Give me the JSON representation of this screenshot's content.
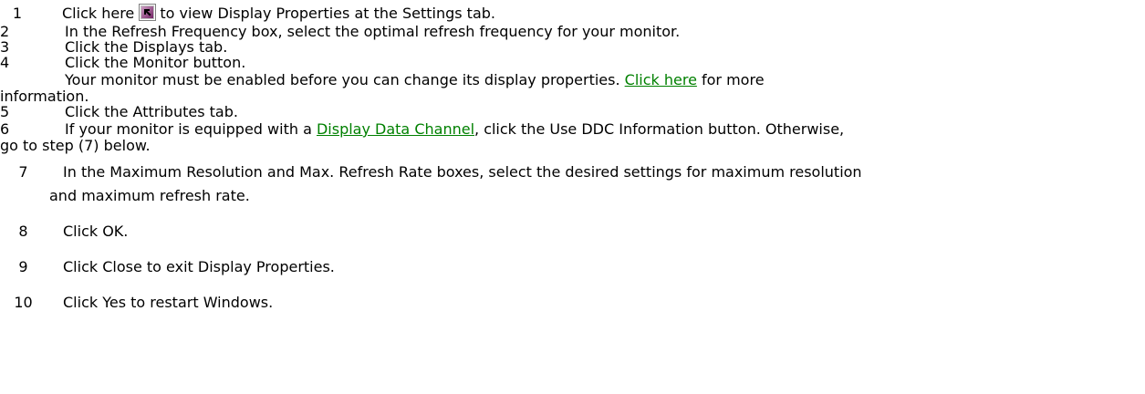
{
  "steps": {
    "s1": {
      "number": "1",
      "before_icon": "Click here",
      "icon": "shortcut-arrow-icon",
      "after_icon": "to view Display Properties at the Settings tab."
    },
    "s2": {
      "number": "2",
      "text": "In the Refresh Frequency box, select the optimal refresh frequency for your monitor."
    },
    "s3": {
      "number": "3",
      "text": "Click the Displays tab."
    },
    "s4": {
      "number": "4",
      "text": "Click the Monitor button."
    },
    "note": {
      "before_link": "Your monitor must be enabled before you can change its display properties.",
      "link": "Click here",
      "after_link": "for more",
      "continuation": "information."
    },
    "s5": {
      "number": "5",
      "text": "Click the Attributes tab."
    },
    "s6": {
      "number": "6",
      "before_link": "If your monitor is equipped with a",
      "link": "Display Data Channel",
      "after_link": ", click the Use DDC Information button. Otherwise,",
      "continuation": "go to step (7) below."
    },
    "s7": {
      "number": "7",
      "text": "In the Maximum Resolution and Max. Refresh Rate boxes, select the desired settings for maximum resolution",
      "continuation": "and maximum refresh rate."
    },
    "s8": {
      "number": "8",
      "text": "Click OK."
    },
    "s9": {
      "number": "9",
      "text": "Click Close to exit Display Properties."
    },
    "s10": {
      "number": "10",
      "text": "Click Yes to restart Windows."
    }
  },
  "colors": {
    "link": "#008000",
    "text": "#000000",
    "background": "#ffffff"
  }
}
